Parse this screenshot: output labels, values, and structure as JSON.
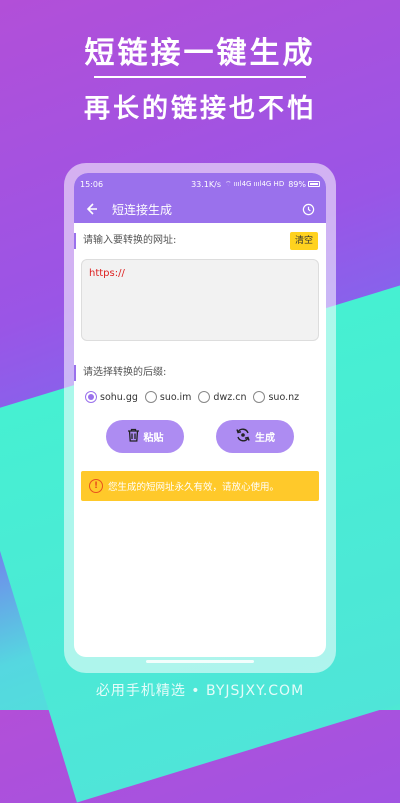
{
  "promo": {
    "headline_top": "短链接一键生成",
    "headline_bottom": "再长的链接也不怕",
    "footer": "必用手机精选 • BYJSJXY.COM"
  },
  "statusbar": {
    "time": "15:06",
    "speed": "33.1K/s",
    "signal": "⌔ ıııl4G ıııl4G HD",
    "battery": "89%"
  },
  "toolbar": {
    "title": "短连接生成",
    "back_icon": "back-arrow-icon",
    "history_icon": "clock-icon"
  },
  "input_section": {
    "label": "请输入要转换的网址:",
    "clear_label": "清空",
    "url_value": "https://"
  },
  "suffix_section": {
    "label": "请选择转换的后缀:",
    "options": [
      "sohu.gg",
      "suo.im",
      "dwz.cn",
      "suo.nz"
    ],
    "selected": "sohu.gg"
  },
  "actions": {
    "paste_label": "粘贴",
    "generate_label": "生成"
  },
  "notice": {
    "text": "您生成的短网址永久有效，请放心使用。"
  },
  "colors": {
    "accent": "#9a71ec",
    "button": "#ad8cf2",
    "clear": "#ffd21f",
    "notice": "#ffc92a",
    "url_text": "#dd2222"
  }
}
